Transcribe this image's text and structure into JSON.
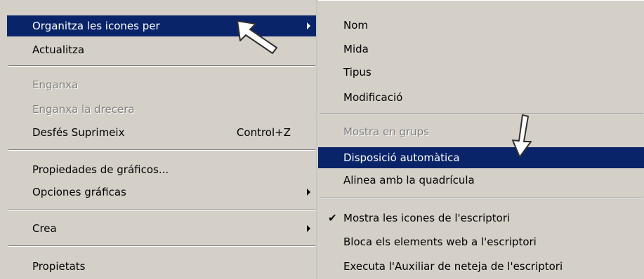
{
  "left_menu": {
    "items": [
      {
        "label": "Organitza les icones per",
        "state": "selected",
        "submenu": true
      },
      {
        "label": "Actualitza"
      },
      {
        "label": "Enganxa",
        "state": "disabled"
      },
      {
        "label": "Enganxa la drecera",
        "state": "disabled"
      },
      {
        "label": "Desfés Suprimeix",
        "shortcut": "Control+Z"
      },
      {
        "label": "Propiedades de gráficos..."
      },
      {
        "label": "Opciones gráficas",
        "submenu": true
      },
      {
        "label": "Crea",
        "submenu": true
      },
      {
        "label": "Propietats"
      }
    ]
  },
  "right_menu": {
    "items": [
      {
        "label": "Nom"
      },
      {
        "label": "Mida"
      },
      {
        "label": "Tipus"
      },
      {
        "label": "Modificació"
      },
      {
        "label": "Mostra en grups",
        "state": "disabled"
      },
      {
        "label": "Disposició automàtica",
        "state": "selected"
      },
      {
        "label": "Alinea amb la quadrícula"
      },
      {
        "label": "Mostra les icones  de l'escriptori",
        "checked": true
      },
      {
        "label": "Bloca els elements web a l'escriptori"
      },
      {
        "label": "Executa l'Auxiliar de neteja de l'escriptori"
      }
    ]
  },
  "colors": {
    "menu_bg": "#d4d0c8",
    "selection_bg": "#0a246a",
    "selection_text": "#ffffff",
    "disabled_text": "#808080"
  }
}
